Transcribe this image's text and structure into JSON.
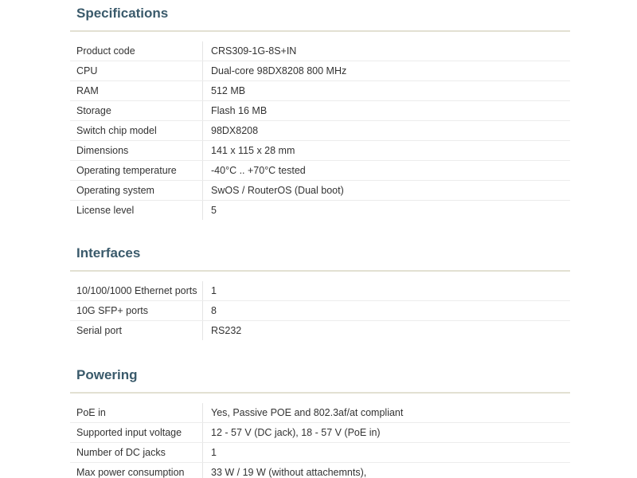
{
  "specifications": {
    "title": "Specifications",
    "rows": [
      {
        "label": "Product code",
        "value": "CRS309-1G-8S+IN"
      },
      {
        "label": "CPU",
        "value": "Dual-core 98DX8208 800 MHz"
      },
      {
        "label": "RAM",
        "value": "512 MB"
      },
      {
        "label": "Storage",
        "value": "Flash 16 MB"
      },
      {
        "label": "Switch chip model",
        "value": "98DX8208"
      },
      {
        "label": "Dimensions",
        "value": "141 x 115 x 28 mm"
      },
      {
        "label": "Operating temperature",
        "value": "-40°C .. +70°C tested"
      },
      {
        "label": "Operating system",
        "value": "SwOS / RouterOS (Dual boot)"
      },
      {
        "label": "License level",
        "value": "5"
      }
    ]
  },
  "interfaces": {
    "title": "Interfaces",
    "rows": [
      {
        "label": "10/100/1000 Ethernet ports",
        "value": "1"
      },
      {
        "label": "10G SFP+ ports",
        "value": "8"
      },
      {
        "label": "Serial port",
        "value": "RS232"
      }
    ]
  },
  "powering": {
    "title": "Powering",
    "rows": [
      {
        "label": "PoE in",
        "value": "Yes, Passive POE and 802.3af/at compliant"
      },
      {
        "label": "Supported input voltage",
        "value": "12 - 57 V (DC jack), 18 - 57 V (PoE in)"
      },
      {
        "label": "Number of DC jacks",
        "value": "1"
      },
      {
        "label": "Max power consumption",
        "value": "33 W / 19 W (without attachemnts),"
      }
    ]
  },
  "colors": {
    "heading": "#3a5a6b",
    "rule": "#e2e0d2",
    "text": "#333333"
  }
}
